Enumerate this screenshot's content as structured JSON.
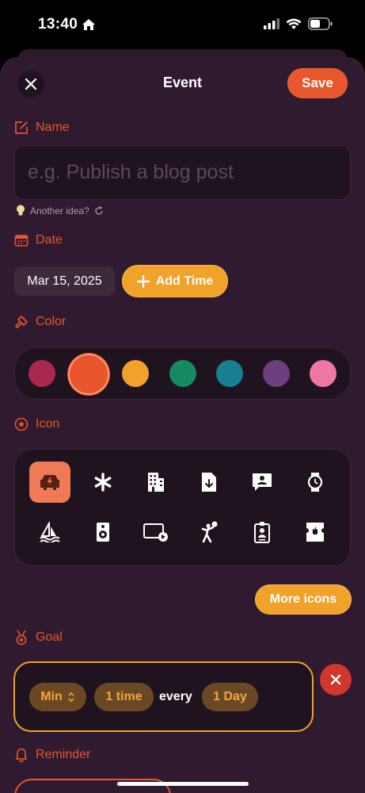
{
  "status_bar": {
    "time": "13:40"
  },
  "header": {
    "title": "Event",
    "save_label": "Save"
  },
  "sections": {
    "name": "Name",
    "date": "Date",
    "color": "Color",
    "icon": "Icon",
    "goal": "Goal",
    "reminder": "Reminder"
  },
  "name_field": {
    "placeholder": "e.g. Publish a blog post",
    "value": ""
  },
  "idea": {
    "label": "Another idea?"
  },
  "date": {
    "value": "Mar 15, 2025",
    "add_time_label": "Add Time"
  },
  "colors": {
    "selected_index": 1,
    "swatches": [
      "#a8294f",
      "#e8552c",
      "#f0a22a",
      "#168a63",
      "#1a7f93",
      "#6e3f7e",
      "#ef77a6"
    ]
  },
  "icons": {
    "selected_index": 0,
    "items": [
      "car-icon",
      "asterisk-icon",
      "building-icon",
      "file-download-icon",
      "contact-bubble-icon",
      "watch-icon",
      "sailing-icon",
      "speaker-icon",
      "screen-play-icon",
      "volleyball-icon",
      "id-badge-icon",
      "apple-ticket-icon"
    ]
  },
  "more_icons_label": "More icons",
  "goal": {
    "mode": "Min",
    "count": "1 time",
    "every": "every",
    "period": "1 Day"
  },
  "accent_color": "#e8572c",
  "secondary_color": "#f0a22a"
}
